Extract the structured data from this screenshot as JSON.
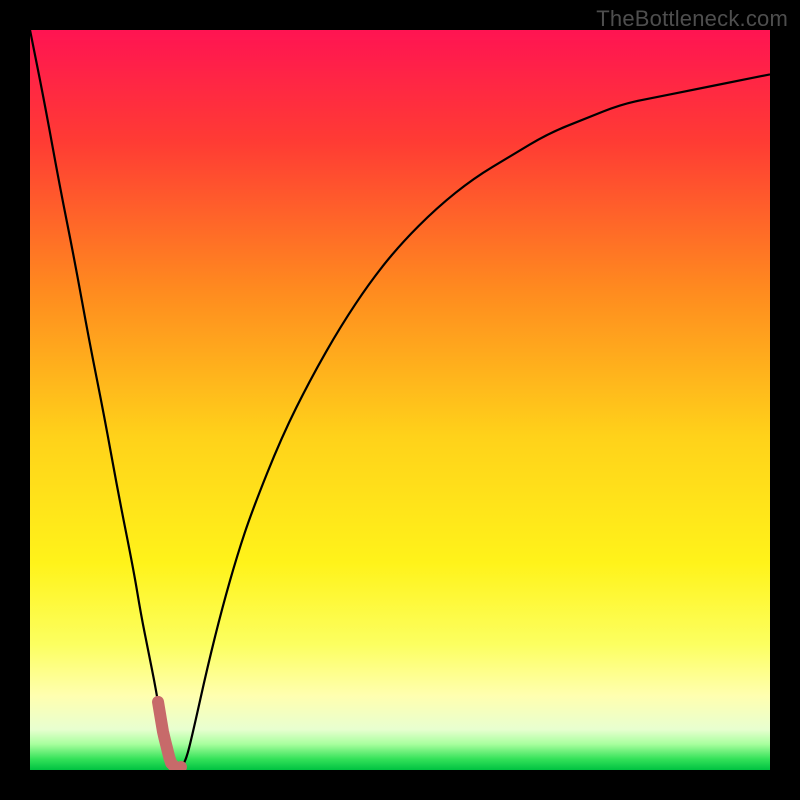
{
  "watermark": "TheBottleneck.com",
  "chart_data": {
    "type": "line",
    "title": "",
    "xlabel": "",
    "ylabel": "",
    "xlim": [
      0,
      100
    ],
    "ylim": [
      0,
      100
    ],
    "grid": false,
    "legend": false,
    "x": [
      0,
      2,
      4,
      6,
      8,
      10,
      12,
      14,
      15,
      16,
      17,
      18,
      19,
      20,
      21,
      22,
      24,
      26,
      28,
      30,
      34,
      38,
      42,
      46,
      50,
      55,
      60,
      65,
      70,
      75,
      80,
      85,
      90,
      95,
      100
    ],
    "values": [
      100,
      90,
      79,
      69,
      58,
      48,
      37,
      27,
      21,
      16,
      11,
      5,
      1,
      0,
      1,
      5,
      14,
      22,
      29,
      35,
      45,
      53,
      60,
      66,
      71,
      76,
      80,
      83,
      86,
      88,
      90,
      91,
      92,
      93,
      94
    ],
    "notch_x_range": [
      17.3,
      20.4
    ],
    "gradient_stops": [
      {
        "pos": 0.0,
        "color": "#ff1452"
      },
      {
        "pos": 0.15,
        "color": "#ff3b34"
      },
      {
        "pos": 0.35,
        "color": "#ff8a1f"
      },
      {
        "pos": 0.55,
        "color": "#ffd21a"
      },
      {
        "pos": 0.72,
        "color": "#fff31a"
      },
      {
        "pos": 0.83,
        "color": "#fcff60"
      },
      {
        "pos": 0.9,
        "color": "#ffffb0"
      },
      {
        "pos": 0.945,
        "color": "#e8ffd0"
      },
      {
        "pos": 0.965,
        "color": "#a8ff9e"
      },
      {
        "pos": 0.985,
        "color": "#35e25a"
      },
      {
        "pos": 1.0,
        "color": "#00c241"
      }
    ],
    "notch_marker_color": "#c76a6a"
  }
}
